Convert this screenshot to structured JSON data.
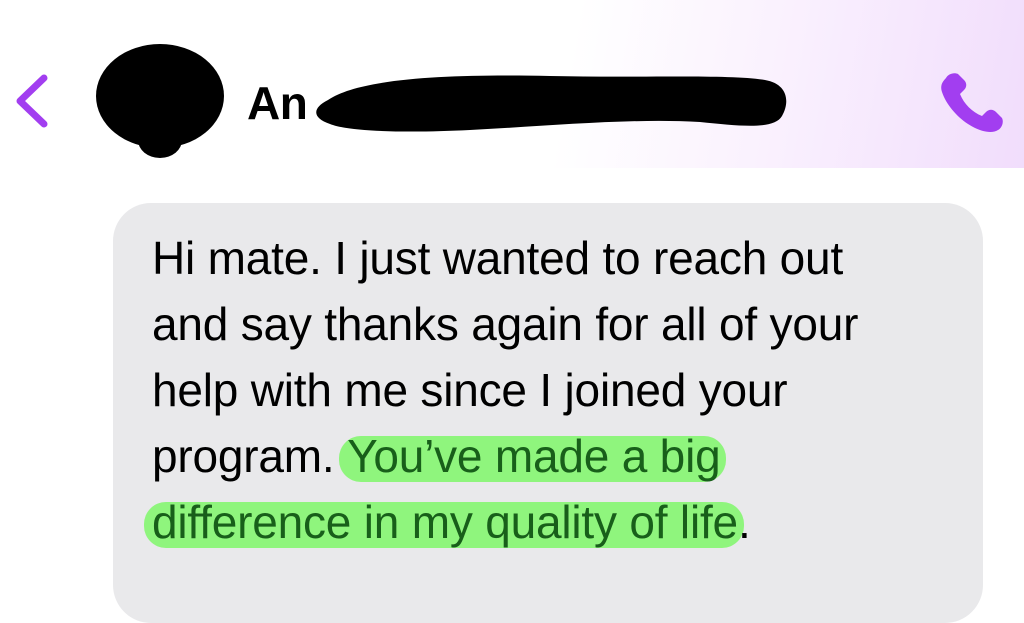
{
  "header": {
    "contact_name": "An",
    "back_icon": "chevron-left-icon",
    "call_icon": "phone-icon",
    "accent_color": "#a23ef0"
  },
  "message": {
    "lines": [
      "Hi mate. I just wanted to reach out",
      "and say thanks again for all of your",
      "help with me since I joined your",
      "program. "
    ],
    "highlight_part1": "You’ve made a big",
    "highlight_part2": "difference in my quality of life",
    "end_punct": ".",
    "highlight_color": "#8ff57d",
    "bubble_color": "#e9e9eb"
  }
}
